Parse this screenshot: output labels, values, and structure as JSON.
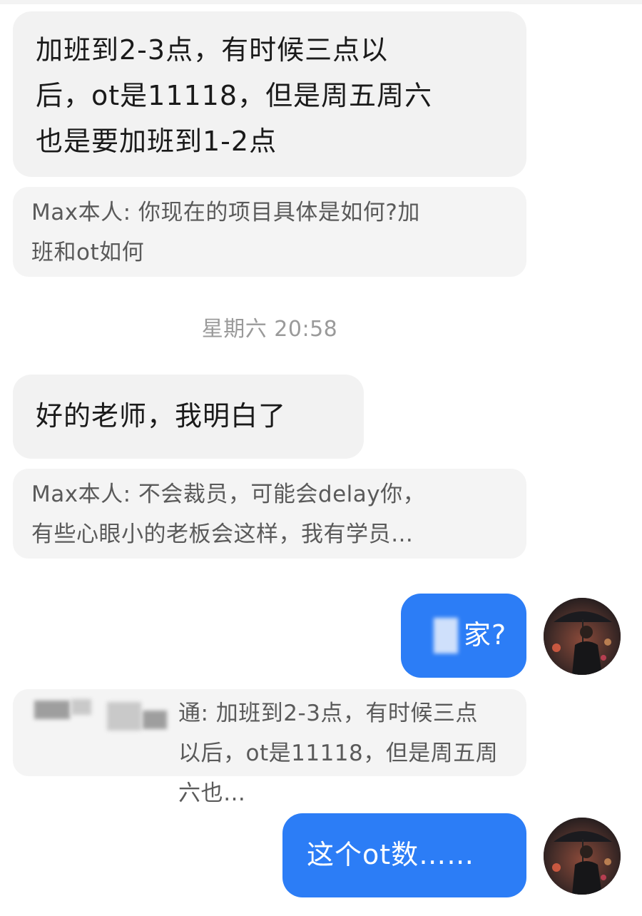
{
  "chat": {
    "messages": [
      {
        "type": "incoming",
        "text": "加班到2-3点，有时候三点以\n后，ot是11118，但是周五周六\n也是要加班到1-2点"
      },
      {
        "type": "quote",
        "author": "Max本人",
        "text": "Max本人: 你现在的项目具体是如何?加\n班和ot如何"
      },
      {
        "type": "timestamp",
        "text": "星期六 20:58"
      },
      {
        "type": "incoming",
        "text": "好的老师，我明白了"
      },
      {
        "type": "quote",
        "author": "Max本人",
        "text": "Max本人: 不会裁员，可能会delay你，\n有些心眼小的老板会这样，我有学员…"
      },
      {
        "type": "outgoing",
        "text": "家?"
      },
      {
        "type": "quote",
        "text": "通: 加班到2-3点，有时候三点\n以后，ot是11118，但是周五周六也…"
      },
      {
        "type": "outgoing",
        "text": "这个ot数……"
      }
    ]
  },
  "colors": {
    "outgoing_bubble": "#2c7df6",
    "incoming_bubble": "#f2f2f2",
    "quote_bubble": "#f4f4f4",
    "timestamp": "#9a9a9a"
  },
  "icons": {
    "self_avatar": "person-with-umbrella-avatar"
  }
}
